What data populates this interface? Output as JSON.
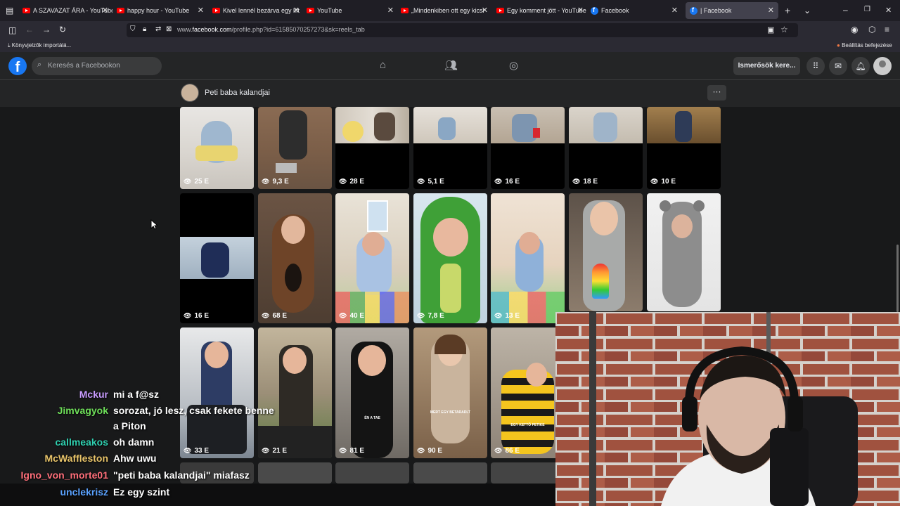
{
  "browser": {
    "tabs": [
      {
        "title": "A SZAVAZAT ÁRA - YouTube",
        "icon": "youtube-icon"
      },
      {
        "title": "happy hour - YouTube",
        "icon": "youtube-icon"
      },
      {
        "title": "Kivel lennél bezárva egy lift",
        "icon": "youtube-icon"
      },
      {
        "title": "YouTube",
        "icon": "youtube-icon"
      },
      {
        "title": "„Mindenkiben ott egy kicsi",
        "icon": "youtube-icon"
      },
      {
        "title": "Egy komment jött - YouTube",
        "icon": "youtube-icon"
      },
      {
        "title": "Facebook",
        "icon": "facebook-icon"
      },
      {
        "title": "| Facebook",
        "icon": "facebook-icon"
      }
    ],
    "url_prefix": "www.",
    "url_domain": "facebook.com",
    "url_path": "/profile.php?id=61585070257273&sk=reels_tab",
    "bookmark_import": "Könyvjelzők importálá...",
    "finish_setup": "Beállítás befejezése"
  },
  "facebook": {
    "search_placeholder": "Keresés a Facebookon",
    "friends_button": "Ismerősök kere...",
    "profile_name": "Peti baba kalandjai",
    "more_button": "···"
  },
  "reels": {
    "row1": [
      "25 E",
      "9,3 E",
      "28 E",
      "5,1 E",
      "16 E",
      "18 E",
      "10 E"
    ],
    "row2": [
      "16 E",
      "68 E",
      "40 E",
      "7,8 E",
      "13 E"
    ],
    "row3": [
      "33 E",
      "21 E",
      "81 E",
      "90 E",
      "86 E"
    ],
    "captions": {
      "r3c3": "ÉN A TAE",
      "r3c4": "MERT EGY BETARADLT",
      "r3c5": "EGY KETTŐ PETIKE"
    }
  },
  "chat": [
    {
      "user": "Mckur",
      "color": "#c89cff",
      "message": "mi a f@sz"
    },
    {
      "user": "Jimvagyok",
      "color": "#6fe05a",
      "message": "sorozat, jó lesz, csak fekete benne",
      "message2": "a Piton"
    },
    {
      "user": "callmeakos",
      "color": "#2fd0b0",
      "message": "oh damn"
    },
    {
      "user": "McWaffleston",
      "color": "#e8c46a",
      "message": "Ahw uwu"
    },
    {
      "user": "Igno_von_morte01",
      "color": "#ff6f7a",
      "message": "\"peti baba kalandjai\" miafasz"
    },
    {
      "user": "unclekrisz",
      "color": "#5aa2ff",
      "message": "Ez egy szint"
    }
  ]
}
